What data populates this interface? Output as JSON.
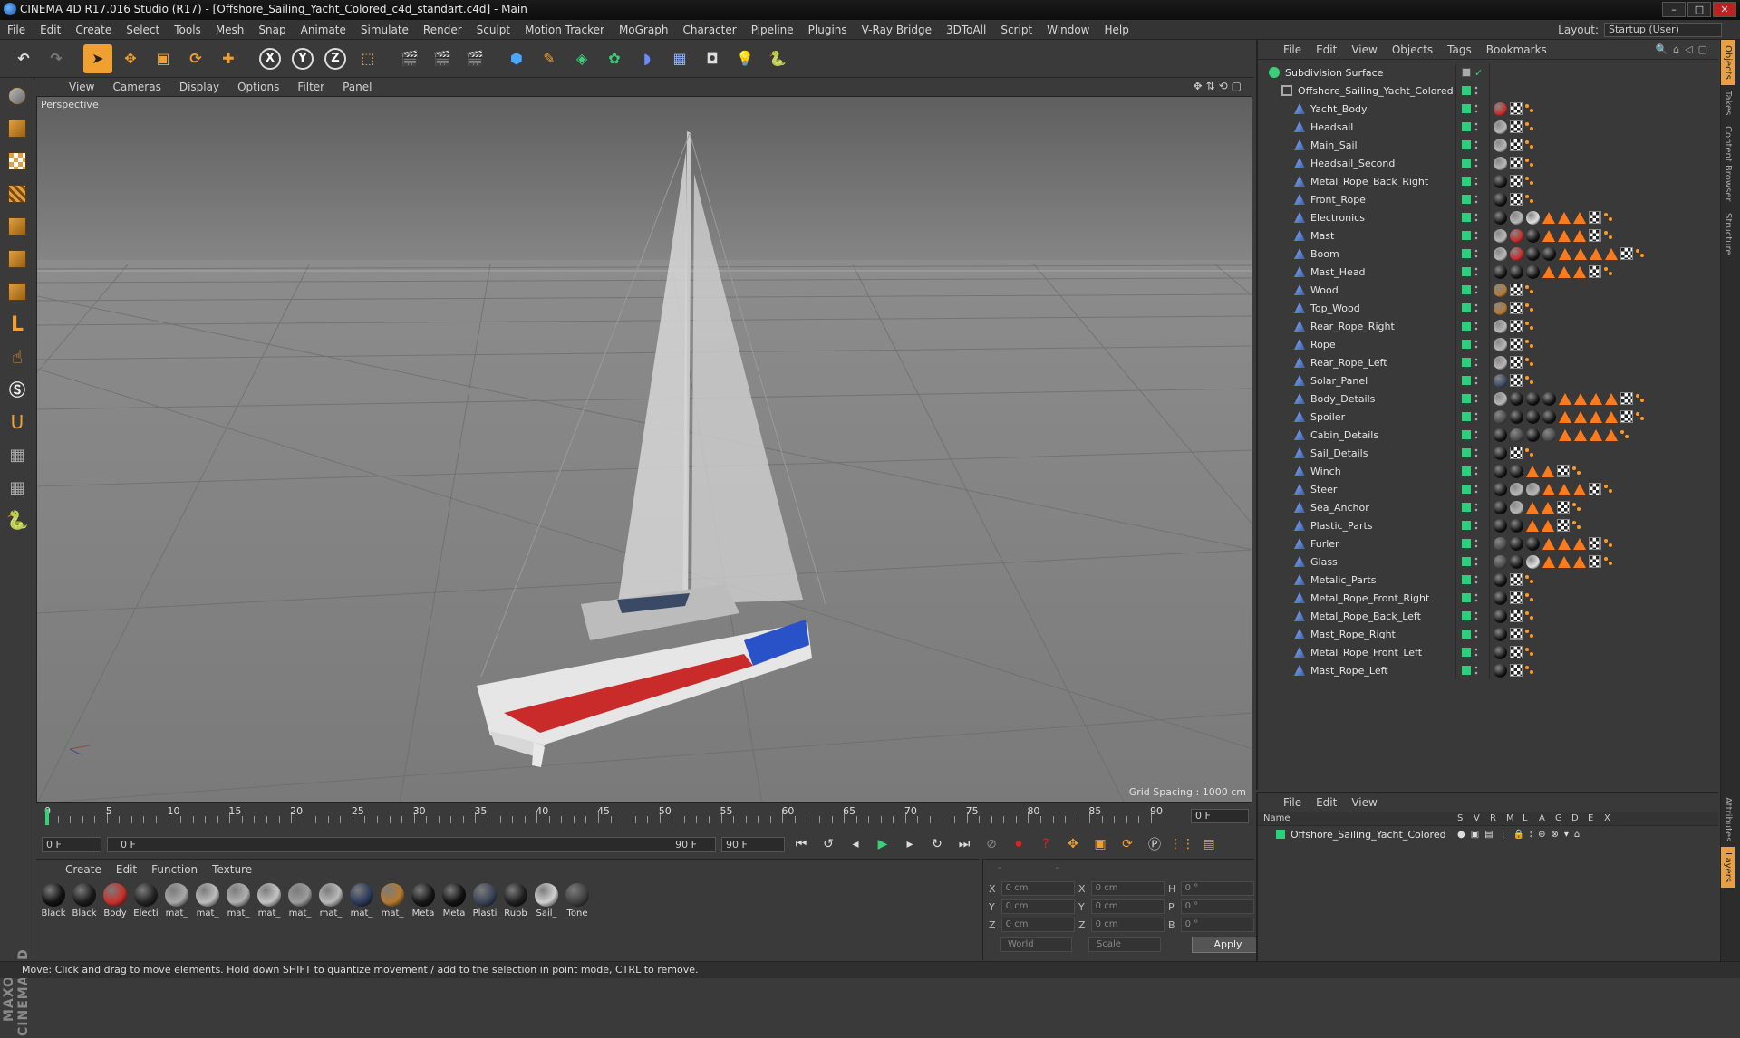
{
  "title": "CINEMA 4D R17.016 Studio (R17) - [Offshore_Sailing_Yacht_Colored_c4d_standart.c4d] - Main",
  "menu": [
    "File",
    "Edit",
    "Create",
    "Select",
    "Tools",
    "Mesh",
    "Snap",
    "Animate",
    "Simulate",
    "Render",
    "Sculpt",
    "Motion Tracker",
    "MoGraph",
    "Character",
    "Pipeline",
    "Plugins",
    "V-Ray Bridge",
    "3DToAll",
    "Script",
    "Window",
    "Help"
  ],
  "layout": {
    "label": "Layout:",
    "value": "Startup (User)"
  },
  "viewport": {
    "menu": [
      "View",
      "Cameras",
      "Display",
      "Options",
      "Filter",
      "Panel"
    ],
    "label": "Perspective",
    "grid_spacing": "Grid Spacing : 1000 cm"
  },
  "timeline": {
    "ticks": [
      "0",
      "5",
      "10",
      "15",
      "20",
      "25",
      "30",
      "35",
      "40",
      "45",
      "50",
      "55",
      "60",
      "65",
      "70",
      "75",
      "80",
      "85",
      "90"
    ],
    "current_frame": "0 F",
    "start_field": "0 F",
    "slider_start": "0 F",
    "slider_end": "90 F",
    "end_field": "90 F"
  },
  "materials": {
    "menu": [
      "Create",
      "Edit",
      "Function",
      "Texture"
    ],
    "items": [
      {
        "label": "Black",
        "color": "#111111"
      },
      {
        "label": "Black",
        "color": "#1a1a1a"
      },
      {
        "label": "Body",
        "color": "#c8302a"
      },
      {
        "label": "Electi",
        "color": "#222222"
      },
      {
        "label": "mat_",
        "color": "#a8a8a8"
      },
      {
        "label": "mat_",
        "color": "#bdbdbd"
      },
      {
        "label": "mat_",
        "color": "#b0b0b0"
      },
      {
        "label": "mat_",
        "color": "#c4c4c4"
      },
      {
        "label": "mat_",
        "color": "#9c9c9c"
      },
      {
        "label": "mat_",
        "color": "#bababa"
      },
      {
        "label": "mat_",
        "color": "#2a3a5a"
      },
      {
        "label": "mat_",
        "color": "#b57a2e"
      },
      {
        "label": "Meta",
        "color": "#151515"
      },
      {
        "label": "Meta",
        "color": "#111111"
      },
      {
        "label": "Plasti",
        "color": "#3a4458"
      },
      {
        "label": "Rubb",
        "color": "#1e1e1e"
      },
      {
        "label": "Sail_",
        "color": "#d0d0d0"
      },
      {
        "label": "Tone",
        "color": "#404040"
      }
    ]
  },
  "coords": {
    "rows": [
      {
        "a1": "X",
        "v1": "0 cm",
        "a2": "X",
        "v2": "0 cm",
        "a3": "H",
        "v3": "0 °"
      },
      {
        "a1": "Y",
        "v1": "0 cm",
        "a2": "Y",
        "v2": "0 cm",
        "a3": "P",
        "v3": "0 °"
      },
      {
        "a1": "Z",
        "v1": "0 cm",
        "a2": "Z",
        "v2": "0 cm",
        "a3": "B",
        "v3": "0 °"
      }
    ],
    "world": "World",
    "scale": "Scale",
    "apply": "Apply"
  },
  "status": "Move: Click and drag to move elements. Hold down SHIFT to quantize movement / add to the selection in point mode, CTRL to remove.",
  "objects": {
    "menu": [
      "File",
      "Edit",
      "View",
      "Objects",
      "Tags",
      "Bookmarks"
    ],
    "root": "Subdivision Surface",
    "group": "Offshore_Sailing_Yacht_Colored",
    "items": [
      {
        "name": "Yacht_Body",
        "tags": "mc"
      },
      {
        "name": "Headsail",
        "tags": "gc"
      },
      {
        "name": "Main_Sail",
        "tags": "gc"
      },
      {
        "name": "Headsail_Second",
        "tags": "gc"
      },
      {
        "name": "Metal_Rope_Back_Right",
        "tags": "bc"
      },
      {
        "name": "Front_Rope",
        "tags": "bc"
      },
      {
        "name": "Electronics",
        "tags": "bgwtttc"
      },
      {
        "name": "Mast",
        "tags": "gmbtttc"
      },
      {
        "name": "Boom",
        "tags": "gmbbttttc"
      },
      {
        "name": "Mast_Head",
        "tags": "bbbtttc"
      },
      {
        "name": "Wood",
        "tags": "oc"
      },
      {
        "name": "Top_Wood",
        "tags": "oc"
      },
      {
        "name": "Rear_Rope_Right",
        "tags": "gc"
      },
      {
        "name": "Rope",
        "tags": "gc"
      },
      {
        "name": "Rear_Rope_Left",
        "tags": "gc"
      },
      {
        "name": "Solar_Panel",
        "tags": "sc"
      },
      {
        "name": "Body_Details",
        "tags": "gbbbttttc"
      },
      {
        "name": "Spoiler",
        "tags": "dbbbttttc"
      },
      {
        "name": "Cabin_Details",
        "tags": "bdbdtttt"
      },
      {
        "name": "Sail_Details",
        "tags": "bc"
      },
      {
        "name": "Winch",
        "tags": "bbttc"
      },
      {
        "name": "Steer",
        "tags": "bggtttc"
      },
      {
        "name": "Sea_Anchor",
        "tags": "bgttc"
      },
      {
        "name": "Plastic_Parts",
        "tags": "bbttc"
      },
      {
        "name": "Furler",
        "tags": "dbbtttc"
      },
      {
        "name": "Glass",
        "tags": "dbwtttc"
      },
      {
        "name": "Metalic_Parts",
        "tags": "bc"
      },
      {
        "name": "Metal_Rope_Front_Right",
        "tags": "bc"
      },
      {
        "name": "Metal_Rope_Back_Left",
        "tags": "bc"
      },
      {
        "name": "Mast_Rope_Right",
        "tags": "bc"
      },
      {
        "name": "Metal_Rope_Front_Left",
        "tags": "bc"
      },
      {
        "name": "Mast_Rope_Left",
        "tags": "bc"
      }
    ]
  },
  "layers": {
    "menu": [
      "File",
      "Edit",
      "View"
    ],
    "headers": [
      "Name",
      "S",
      "V",
      "R",
      "M",
      "L",
      "A",
      "G",
      "D",
      "E",
      "X"
    ],
    "row": "Offshore_Sailing_Yacht_Colored"
  },
  "right_tabs": [
    "Objects",
    "Takes",
    "Content Browser",
    "Structure"
  ],
  "right_tabs_bottom": [
    "Attributes",
    "Layers"
  ]
}
